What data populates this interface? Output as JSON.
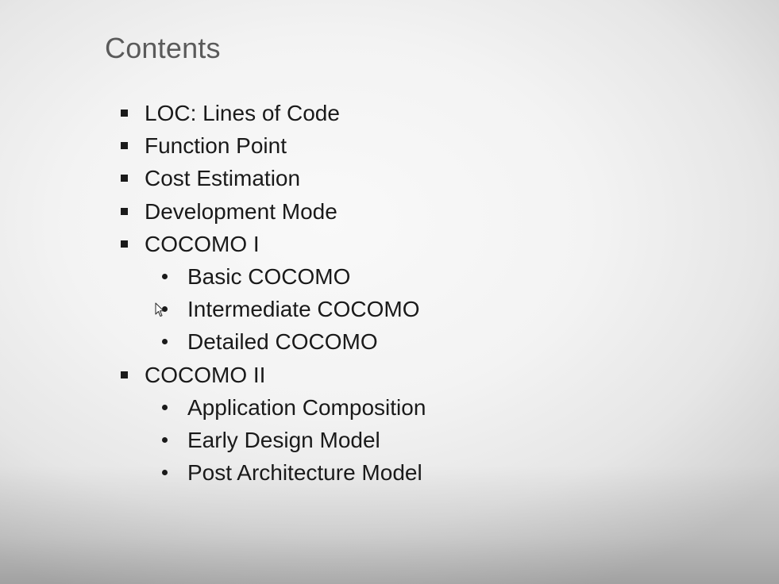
{
  "slide": {
    "title": "Contents",
    "items": [
      {
        "level": 1,
        "text": "LOC: Lines of Code"
      },
      {
        "level": 1,
        "text": "Function Point"
      },
      {
        "level": 1,
        "text": "Cost Estimation"
      },
      {
        "level": 1,
        "text": "Development Mode"
      },
      {
        "level": 1,
        "text": "COCOMO I"
      },
      {
        "level": 2,
        "text": "Basic COCOMO"
      },
      {
        "level": 2,
        "text": "Intermediate COCOMO"
      },
      {
        "level": 2,
        "text": "Detailed COCOMO"
      },
      {
        "level": 1,
        "text": "COCOMO II"
      },
      {
        "level": 2,
        "text": "Application Composition"
      },
      {
        "level": 2,
        "text": "Early Design Model"
      },
      {
        "level": 2,
        "text": "Post Architecture Model"
      }
    ]
  },
  "colors": {
    "title": "#5a5a5a",
    "text": "#1a1a1a"
  },
  "icons": {
    "level1_bullet": "square-bullet-icon",
    "level2_bullet": "round-bullet-icon",
    "pointer": "mouse-cursor-icon"
  }
}
